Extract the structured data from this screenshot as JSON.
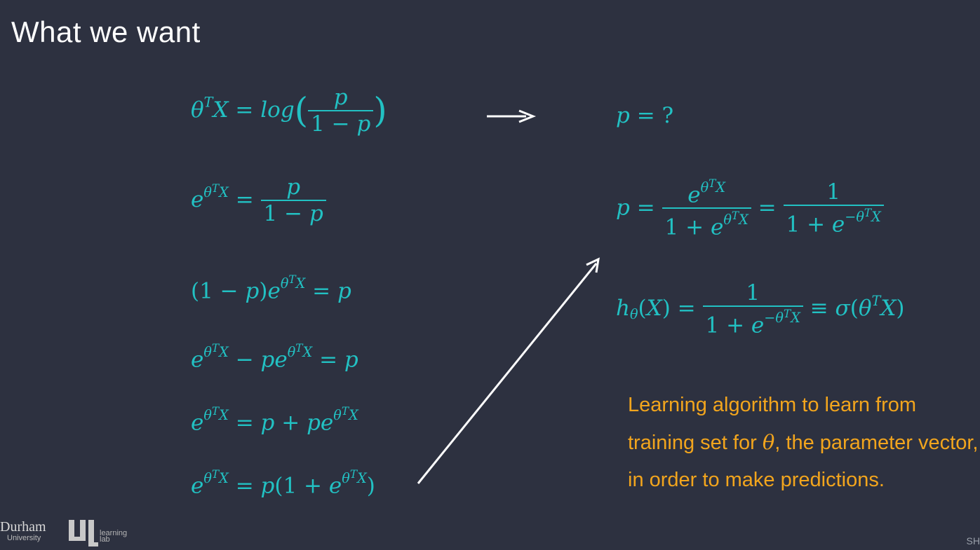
{
  "slide": {
    "title": "What we want",
    "note_text": "Learning algorithm to learn from training set for",
    "note_theta": "θ",
    "note_text2": ", the parameter vector, in order to make predictions.",
    "colors": {
      "background": "#2d3140",
      "equation": "#22c1c3",
      "note": "#f2a51d",
      "title": "#ffffff"
    }
  },
  "equations": {
    "eq1": "θᵀX = log(p / (1 − p))",
    "eq2": "e^(θᵀX) = p / (1 − p)",
    "eq3": "(1 − p)e^(θᵀX) = p",
    "eq4": "e^(θᵀX) − pe^(θᵀX) = p",
    "eq5": "e^(θᵀX) = p + pe^(θᵀX)",
    "eq6": "e^(θᵀX) = p(1 + e^(θᵀX))",
    "r1": "p = ?",
    "r2": "p = e^(θᵀX) / (1 + e^(θᵀX)) = 1 / (1 + e^(−θᵀX))",
    "r3": "h_θ(X) = 1 / (1 + e^(−θᵀX)) ≡ σ(θᵀX)"
  },
  "footer": {
    "durham": "Durham",
    "university": "University",
    "lab_line1": "learning",
    "lab_line2": "lab",
    "corner": "SH"
  }
}
